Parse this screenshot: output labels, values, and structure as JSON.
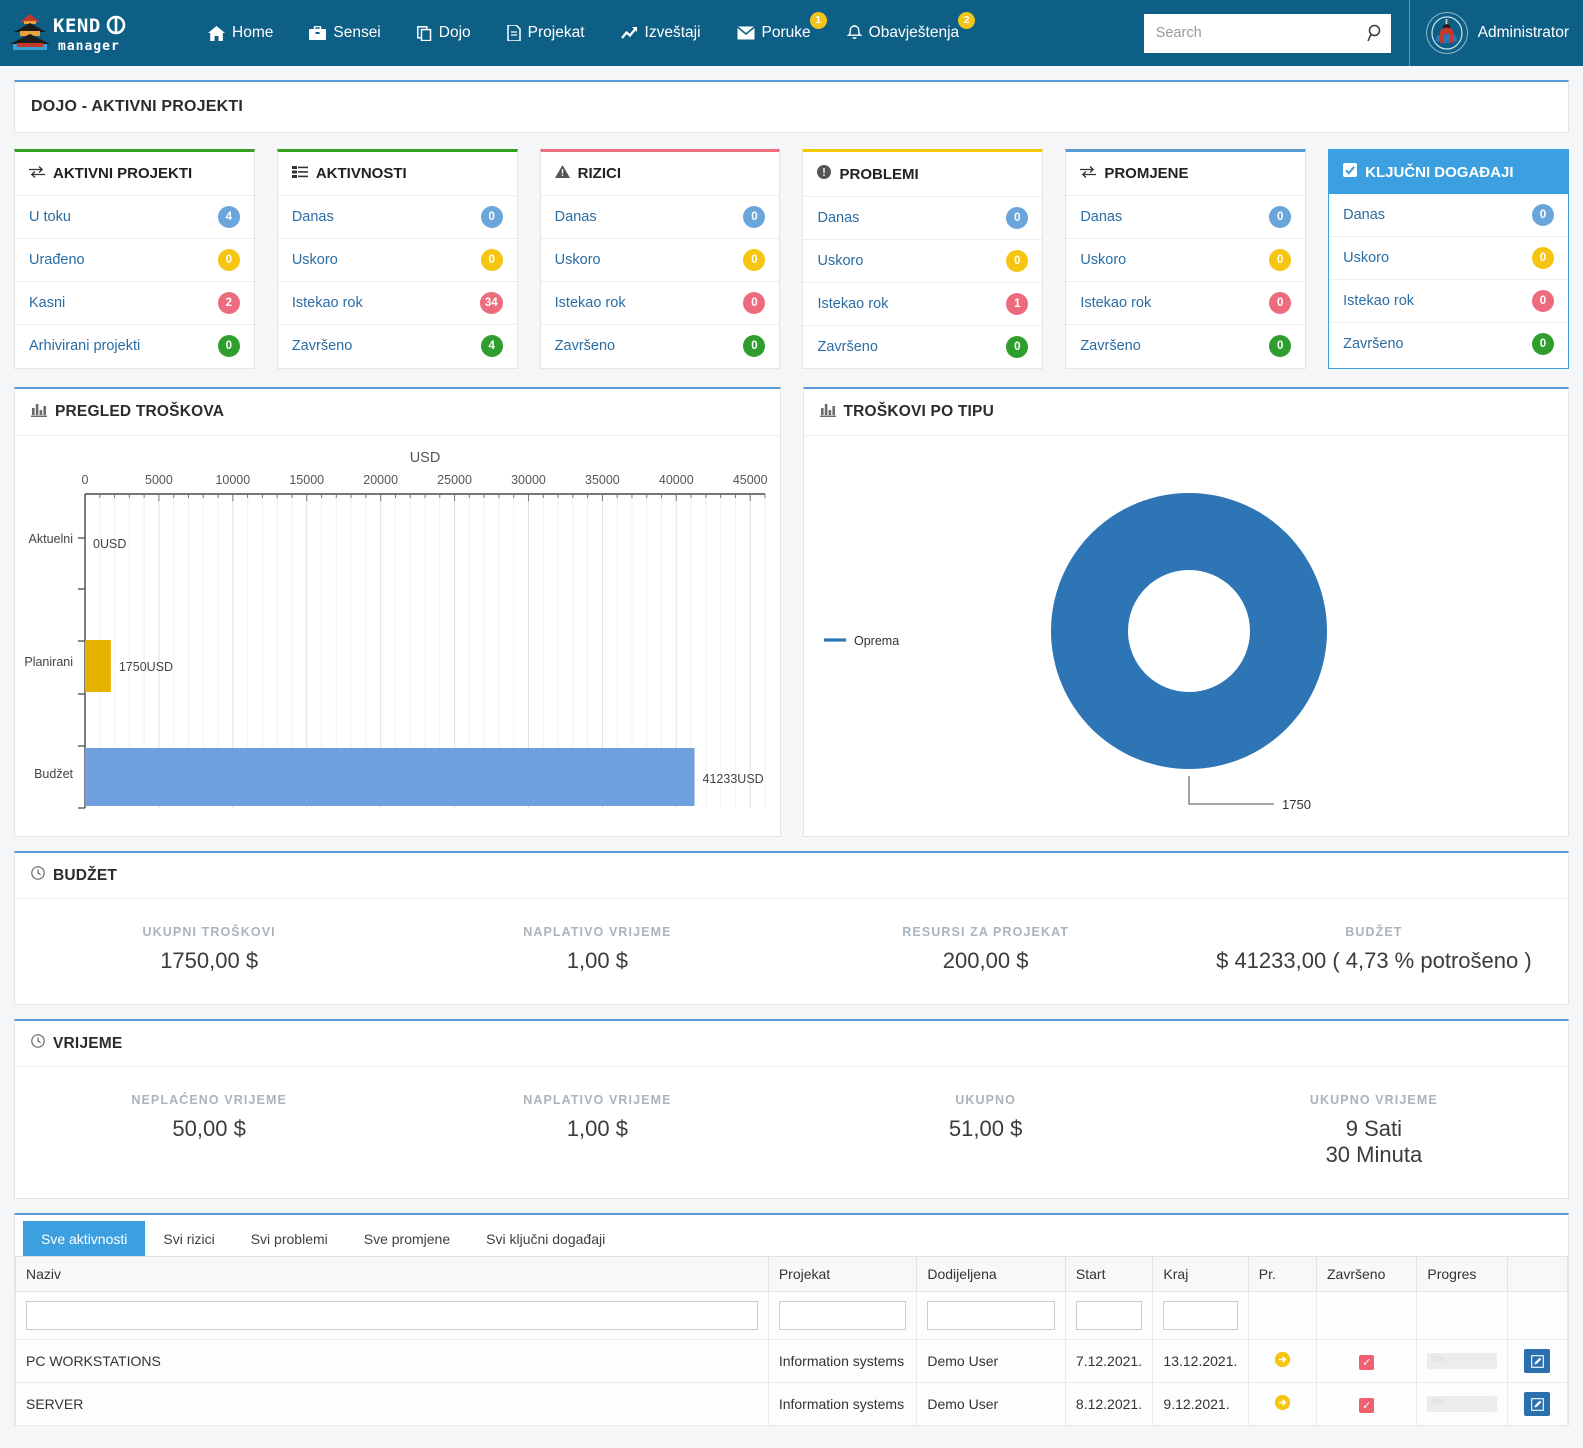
{
  "app": {
    "brand_primary": "Kendo",
    "brand_secondary": "manager",
    "navbar_color": "#0e5f86"
  },
  "nav": {
    "items": [
      {
        "label": "Home",
        "icon": "home-icon",
        "badge": null
      },
      {
        "label": "Sensei",
        "icon": "briefcase-icon",
        "badge": null
      },
      {
        "label": "Dojo",
        "icon": "copy-icon",
        "badge": null
      },
      {
        "label": "Projekat",
        "icon": "file-icon",
        "badge": null
      },
      {
        "label": "Izveštaji",
        "icon": "chart-line-icon",
        "badge": null
      },
      {
        "label": "Poruke",
        "icon": "envelope-icon",
        "badge": "1"
      },
      {
        "label": "Obavještenja",
        "icon": "bell-icon",
        "badge": "2"
      }
    ]
  },
  "search": {
    "placeholder": "Search",
    "value": ""
  },
  "user": {
    "name": "Administrator",
    "avatar": "kendo-warrior-avatar"
  },
  "page_header": {
    "title": "DOJO - AKTIVNI PROJEKTI"
  },
  "cards": [
    {
      "title": "AKTIVNI PROJEKTI",
      "icon": "exchange-icon",
      "accent": "green",
      "selected": false,
      "rows": [
        {
          "label": "U toku",
          "count": "4",
          "color": "blue"
        },
        {
          "label": "Urađeno",
          "count": "0",
          "color": "yellow"
        },
        {
          "label": "Kasni",
          "count": "2",
          "color": "red"
        },
        {
          "label": "Arhivirani projekti",
          "count": "0",
          "color": "green"
        }
      ]
    },
    {
      "title": "AKTIVNOSTI",
      "icon": "tasks-icon",
      "accent": "green",
      "selected": false,
      "rows": [
        {
          "label": "Danas",
          "count": "0",
          "color": "blue"
        },
        {
          "label": "Uskoro",
          "count": "0",
          "color": "yellow"
        },
        {
          "label": "Istekao rok",
          "count": "34",
          "color": "red"
        },
        {
          "label": "Završeno",
          "count": "4",
          "color": "green"
        }
      ]
    },
    {
      "title": "RIZICI",
      "icon": "warning-icon",
      "accent": "pink",
      "selected": false,
      "rows": [
        {
          "label": "Danas",
          "count": "0",
          "color": "blue"
        },
        {
          "label": "Uskoro",
          "count": "0",
          "color": "yellow"
        },
        {
          "label": "Istekao rok",
          "count": "0",
          "color": "red"
        },
        {
          "label": "Završeno",
          "count": "0",
          "color": "green"
        }
      ]
    },
    {
      "title": "PROBLEMI",
      "icon": "exclamation-circle-icon",
      "accent": "yellow",
      "selected": false,
      "rows": [
        {
          "label": "Danas",
          "count": "0",
          "color": "blue"
        },
        {
          "label": "Uskoro",
          "count": "0",
          "color": "yellow"
        },
        {
          "label": "Istekao rok",
          "count": "1",
          "color": "red"
        },
        {
          "label": "Završeno",
          "count": "0",
          "color": "green"
        }
      ]
    },
    {
      "title": "PROMJENE",
      "icon": "exchange-icon",
      "accent": "blue",
      "selected": false,
      "rows": [
        {
          "label": "Danas",
          "count": "0",
          "color": "blue"
        },
        {
          "label": "Uskoro",
          "count": "0",
          "color": "yellow"
        },
        {
          "label": "Istekao rok",
          "count": "0",
          "color": "red"
        },
        {
          "label": "Završeno",
          "count": "0",
          "color": "green"
        }
      ]
    },
    {
      "title": "KLJUČNI DOGAĐAJI",
      "icon": "check-square-icon",
      "accent": "blue",
      "selected": true,
      "rows": [
        {
          "label": "Danas",
          "count": "0",
          "color": "blue"
        },
        {
          "label": "Uskoro",
          "count": "0",
          "color": "yellow"
        },
        {
          "label": "Istekao rok",
          "count": "0",
          "color": "red"
        },
        {
          "label": "Završeno",
          "count": "0",
          "color": "green"
        }
      ]
    }
  ],
  "panels": {
    "cost_overview_title": "PREGLED TROŠKOVA",
    "cost_by_type_title": "TROŠKOVI PO TIPU",
    "budget_title": "BUDŽET",
    "time_title": "VRIJEME"
  },
  "chart_data": [
    {
      "type": "bar",
      "orientation": "horizontal",
      "title": "PREGLED TROŠKOVA",
      "xlabel": "USD",
      "ylabel": "",
      "categories": [
        "Aktuelni",
        "Planirani",
        "Budžet"
      ],
      "values": [
        0,
        1750,
        41233
      ],
      "point_labels": [
        "0USD",
        "1750USD",
        "41233USD"
      ],
      "colors": [
        "#e8b200",
        "#e8b200",
        "#6f9fdc"
      ],
      "xlim": [
        0,
        46000
      ],
      "xticks": [
        0,
        5000,
        10000,
        15000,
        20000,
        25000,
        30000,
        35000,
        40000,
        45000
      ],
      "xticklabels": [
        "0",
        "5000",
        "10000",
        "15000",
        "20000",
        "25000",
        "30000",
        "35000",
        "40000",
        "45000"
      ],
      "grid": true,
      "legend": false
    },
    {
      "type": "pie",
      "subtype": "donut",
      "title": "TROŠKOVI PO TIPU",
      "labels": [
        "Oprema"
      ],
      "values": [
        1750
      ],
      "point_labels": [
        "1750"
      ],
      "colors": [
        "#2e75b6"
      ],
      "legend": "left",
      "legend_entries": [
        "Oprema"
      ]
    }
  ],
  "budget": {
    "items": [
      {
        "label": "UKUPNI TROŠKOVI",
        "value": "1750,00 $"
      },
      {
        "label": "NAPLATIVO VRIJEME",
        "value": "1,00 $"
      },
      {
        "label": "RESURSI ZA PROJEKAT",
        "value": "200,00 $"
      },
      {
        "label": "BUDŽET",
        "value": "$ 41233,00 ( 4,73 % potrošeno )"
      }
    ]
  },
  "time": {
    "items": [
      {
        "label": "NEPLAĆENO VRIJEME",
        "value": "50,00 $",
        "value2": ""
      },
      {
        "label": "NAPLATIVO VRIJEME",
        "value": "1,00 $",
        "value2": ""
      },
      {
        "label": "UKUPNO",
        "value": "51,00 $",
        "value2": ""
      },
      {
        "label": "UKUPNO VRIJEME",
        "value": "9 Sati",
        "value2": "30 Minuta"
      }
    ]
  },
  "bottom": {
    "tabs": [
      {
        "label": "Sve aktivnosti",
        "active": true
      },
      {
        "label": "Svi rizici",
        "active": false
      },
      {
        "label": "Svi problemi",
        "active": false
      },
      {
        "label": "Sve promjene",
        "active": false
      },
      {
        "label": "Svi ključni događaji",
        "active": false
      }
    ],
    "columns": [
      "Naziv",
      "Projekat",
      "Dodijeljena",
      "Start",
      "Kraj",
      "Pr.",
      "Završeno",
      "Progres",
      ""
    ],
    "filters": {
      "naziv": "",
      "projekat": "",
      "dodijeljena": "",
      "start": "",
      "kraj": ""
    },
    "rows": [
      {
        "naziv": "PC WORKSTATIONS",
        "projekat": "Information systems",
        "dodijeljena": "Demo User",
        "start": "7.12.2021.",
        "kraj": "13.12.2021.",
        "prioritet": "arrow-right-circle-icon",
        "zavrseno": "checked",
        "progres": "0%",
        "action": "edit-icon"
      },
      {
        "naziv": "SERVER",
        "projekat": "Information systems",
        "dodijeljena": "Demo User",
        "start": "8.12.2021.",
        "kraj": "9.12.2021.",
        "prioritet": "arrow-right-circle-icon",
        "zavrseno": "checked",
        "progres": "0%",
        "action": "edit-icon"
      }
    ]
  }
}
